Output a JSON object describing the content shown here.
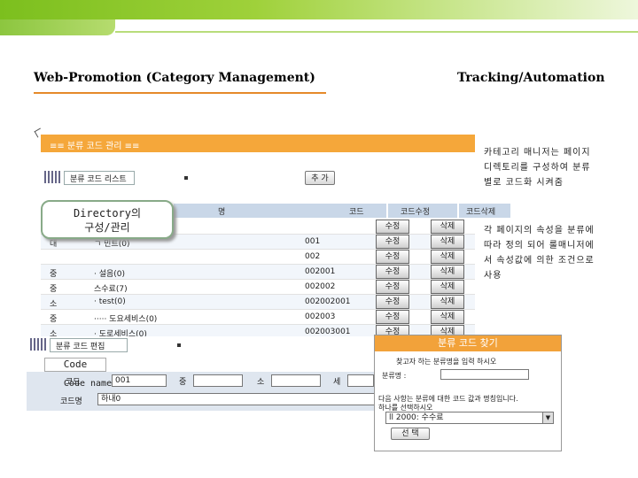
{
  "header": {
    "left_title": "Web-Promotion (Category Management)",
    "right_title": "Tracking/Automation"
  },
  "panel": {
    "bar_title": "≡≡ 분류 코드 관리 ≡≡",
    "list_label": "분류 코드 리스트",
    "add_button": "추 가",
    "columns": [
      "명",
      "코드",
      "코드수정",
      "코드삭제"
    ],
    "rows": [
      {
        "level": "",
        "name": "",
        "code": "",
        "edit": "수정",
        "delete": "삭제"
      },
      {
        "level": "대",
        "name": "ㄱ 민트(0)",
        "code": "001",
        "edit": "수정",
        "delete": "삭제"
      },
      {
        "level": "",
        "name": "",
        "code": "002",
        "edit": "수정",
        "delete": "삭제"
      },
      {
        "level": "중",
        "name": "· 설음(0)",
        "code": "002001",
        "edit": "수정",
        "delete": "삭제"
      },
      {
        "level": "중",
        "name": "스수료(7)",
        "code": "002002",
        "edit": "수정",
        "delete": "삭제"
      },
      {
        "level": "소",
        "name": "· test(0)",
        "code": "002002001",
        "edit": "수정",
        "delete": "삭제"
      },
      {
        "level": "중",
        "name": "····· 도요세비스(0)",
        "code": "002003",
        "edit": "수정",
        "delete": "삭제"
      },
      {
        "level": "소",
        "name": "· 도로세비스(0)",
        "code": "002003001",
        "edit": "수정",
        "delete": "삭제"
      }
    ],
    "edit_label": "분류 코드 편집",
    "edit_fields": {
      "code_label": "코드",
      "code_value": "001",
      "mid_label": "중",
      "small_label": "소",
      "fine_label": "세",
      "name_label": "코드명",
      "name_value": "하내0"
    }
  },
  "callouts": {
    "directory": "Directory의\n구성/관리",
    "code": "Code",
    "code_name": "Code name"
  },
  "popup": {
    "title": "분류 코드 찾기",
    "instruction": "찾고자 하는 분류명을 입력 하시오",
    "field_label": "분류명 :",
    "result_note1": "다음 사항는 분류에 대한 코드 값과 명칭입니다.",
    "result_note2": "하나를 선택하시오",
    "select_value": "ll 2000: 수수료",
    "select_button": "선 택"
  },
  "side_notes": {
    "note1": [
      "카테고리 매니저는 페이지",
      "디렉토리를 구성하여 분류",
      "별로 코드화 시켜줌"
    ],
    "note2": [
      "각 페이지의 속성을 분류에",
      "따라 정의 되어 룰매니저에",
      "서 속성값에 의한 조건으로",
      "사용"
    ]
  },
  "colors": {
    "accent_orange": "#f5a73a",
    "banner_green": "#8cc63f",
    "table_header": "#c9d7e8"
  }
}
